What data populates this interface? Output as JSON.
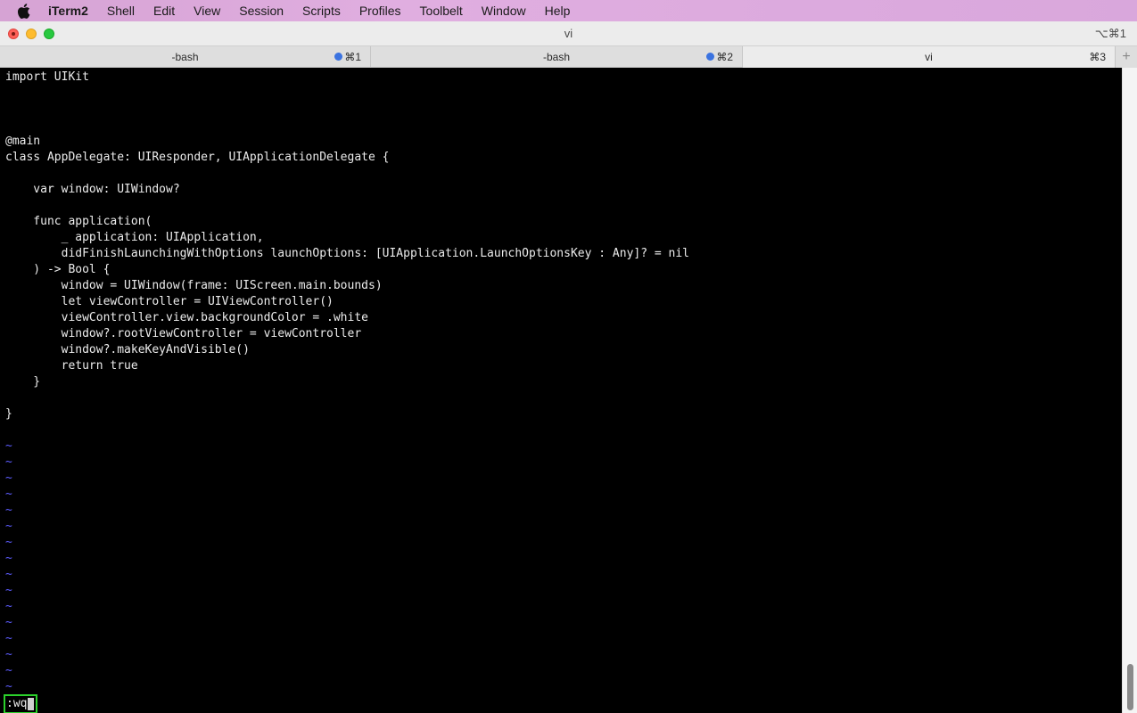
{
  "menubar": {
    "apple_icon": "apple-logo-icon",
    "items": [
      "iTerm2",
      "Shell",
      "Edit",
      "View",
      "Session",
      "Scripts",
      "Profiles",
      "Toolbelt",
      "Window",
      "Help"
    ]
  },
  "window": {
    "title": "vi",
    "shortcut": "⌥⌘1"
  },
  "tabs": [
    {
      "label": "-bash",
      "shortcut": "⌘1",
      "activity_dot": true
    },
    {
      "label": "-bash",
      "shortcut": "⌘2",
      "activity_dot": true
    },
    {
      "label": "vi",
      "shortcut": "⌘3",
      "activity_dot": false
    }
  ],
  "new_tab_label": "+",
  "editor": {
    "lines": [
      "import UIKit",
      "",
      "",
      "",
      "@main",
      "class AppDelegate: UIResponder, UIApplicationDelegate {",
      "",
      "    var window: UIWindow?",
      "",
      "    func application(",
      "        _ application: UIApplication,",
      "        didFinishLaunchingWithOptions launchOptions: [UIApplication.LaunchOptionsKey : Any]? = nil",
      "    ) -> Bool {",
      "        window = UIWindow(frame: UIScreen.main.bounds)",
      "        let viewController = UIViewController()",
      "        viewController.view.backgroundColor = .white",
      "        window?.rootViewController = viewController",
      "        window?.makeKeyAndVisible()",
      "        return true",
      "    }",
      "",
      "}",
      ""
    ],
    "tilde_char": "~",
    "tilde_count": 16,
    "command_line": ":wq"
  },
  "colors": {
    "background": "#000000",
    "foreground": "#ececec",
    "tilde": "#5c5cff",
    "cmd_border": "#2bd12b",
    "tab_dot": "#3b73e0"
  }
}
